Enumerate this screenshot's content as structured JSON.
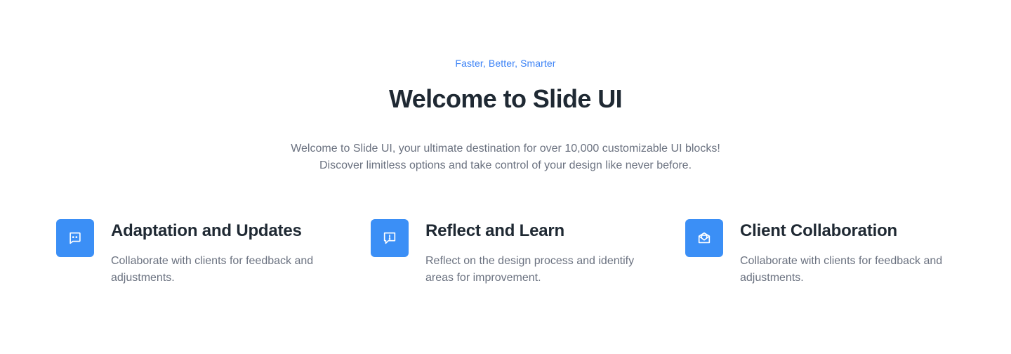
{
  "hero": {
    "eyebrow": "Faster, Better, Smarter",
    "title": "Welcome to Slide UI",
    "subtitle": "Welcome to Slide UI, your ultimate destination for over 10,000 customizable UI blocks! Discover limitless options and take control of your design like never before."
  },
  "features": [
    {
      "icon": "message-square-dots-icon",
      "title": "Adaptation and Updates",
      "description": "Collaborate with clients for feedback and adjustments."
    },
    {
      "icon": "message-alert-icon",
      "title": "Reflect and Learn",
      "description": "Reflect on the design process and identify areas for improvement."
    },
    {
      "icon": "mail-open-icon",
      "title": "Client Collaboration",
      "description": "Collaborate with clients for feedback and adjustments."
    }
  ],
  "colors": {
    "accent": "#3b82f6",
    "icon_background": "#3b8ff6",
    "heading": "#1f2933",
    "body_text": "#6b7280",
    "background": "#ffffff"
  }
}
